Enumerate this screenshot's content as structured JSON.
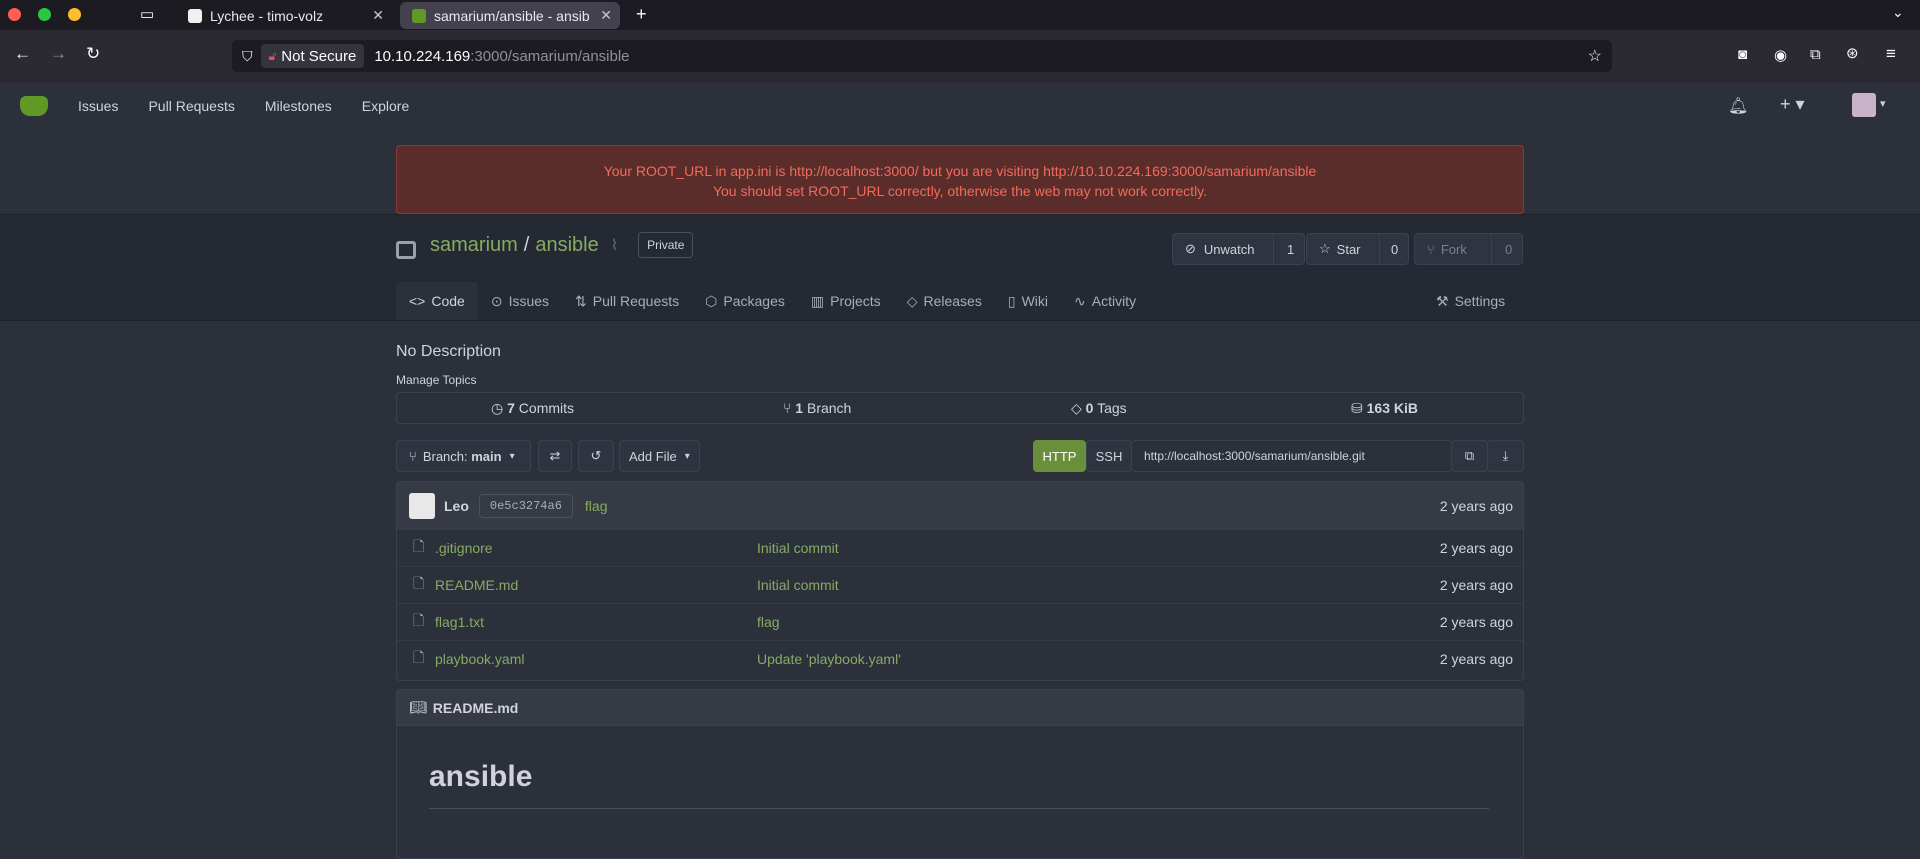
{
  "browser": {
    "tabs": [
      {
        "title": "Lychee - timo-volz"
      },
      {
        "title": "samarium/ansible - ansib"
      }
    ],
    "url_host": "10.10.224.169",
    "url_path": ":3000/samarium/ansible",
    "security_label": "Not Secure"
  },
  "nav": {
    "items": [
      "Issues",
      "Pull Requests",
      "Milestones",
      "Explore"
    ]
  },
  "alert": {
    "line1": "Your ROOT_URL in app.ini is http://localhost:3000/ but you are visiting http://10.10.224.169:3000/samarium/ansible",
    "line2": "You should set ROOT_URL correctly, otherwise the web may not work correctly."
  },
  "repo": {
    "owner": "samarium",
    "separator": "/",
    "name": "ansible",
    "visibility": "Private",
    "unwatch_label": "Unwatch",
    "watch_count": "1",
    "star_label": "Star",
    "star_count": "0",
    "fork_label": "Fork",
    "fork_count": "0"
  },
  "tabs": [
    "Code",
    "Issues",
    "Pull Requests",
    "Packages",
    "Projects",
    "Releases",
    "Wiki",
    "Activity"
  ],
  "settings_label": "Settings",
  "description": "No Description",
  "manage_topics": "Manage Topics",
  "stats": {
    "commits_num": "7",
    "commits_label": "Commits",
    "branch_num": "1",
    "branch_label": "Branch",
    "tags_num": "0",
    "tags_label": "Tags",
    "size": "163 KiB"
  },
  "toolbar": {
    "branch_prefix": "Branch:",
    "branch_name": "main",
    "add_file": "Add File",
    "http": "HTTP",
    "ssh": "SSH",
    "clone_url": "http://localhost:3000/samarium/ansible.git"
  },
  "last_commit": {
    "author": "Leo",
    "sha": "0e5c3274a6",
    "message": "flag",
    "age": "2 years ago"
  },
  "files": [
    {
      "name": ".gitignore",
      "commit": "Initial commit",
      "age": "2 years ago"
    },
    {
      "name": "README.md",
      "commit": "Initial commit",
      "age": "2 years ago"
    },
    {
      "name": "flag1.txt",
      "commit": "flag",
      "age": "2 years ago"
    },
    {
      "name": "playbook.yaml",
      "commit": "Update 'playbook.yaml'",
      "age": "2 years ago"
    }
  ],
  "readme": {
    "filename": "README.md",
    "heading": "ansible"
  }
}
